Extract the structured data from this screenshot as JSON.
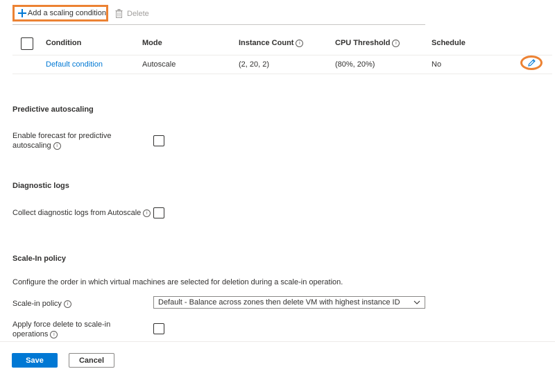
{
  "toolbar": {
    "add_label": "Add a scaling condition",
    "delete_label": "Delete"
  },
  "table": {
    "headers": [
      "Condition",
      "Mode",
      "Instance Count",
      "CPU Threshold",
      "Schedule"
    ],
    "rows": [
      {
        "condition": "Default condition",
        "mode": "Autoscale",
        "instance_count": "(2, 20, 2)",
        "cpu_threshold": "(80%, 20%)",
        "schedule": "No"
      }
    ]
  },
  "predictive": {
    "title": "Predictive autoscaling",
    "label_line1": "Enable forecast for predictive",
    "label_line2": "autoscaling"
  },
  "diagnostic": {
    "title": "Diagnostic logs",
    "label": "Collect diagnostic logs from Autoscale"
  },
  "scale_in": {
    "title": "Scale-In policy",
    "description": "Configure the order in which virtual machines are selected for deletion during a scale-in operation.",
    "policy_label": "Scale-in policy",
    "policy_value": "Default - Balance across zones then delete VM with highest instance ID",
    "force_label_line1": "Apply force delete to scale-in",
    "force_label_line2": "operations"
  },
  "footer": {
    "save_label": "Save",
    "cancel_label": "Cancel"
  },
  "colors": {
    "accent": "#0078d4",
    "highlight": "#ec8233"
  }
}
